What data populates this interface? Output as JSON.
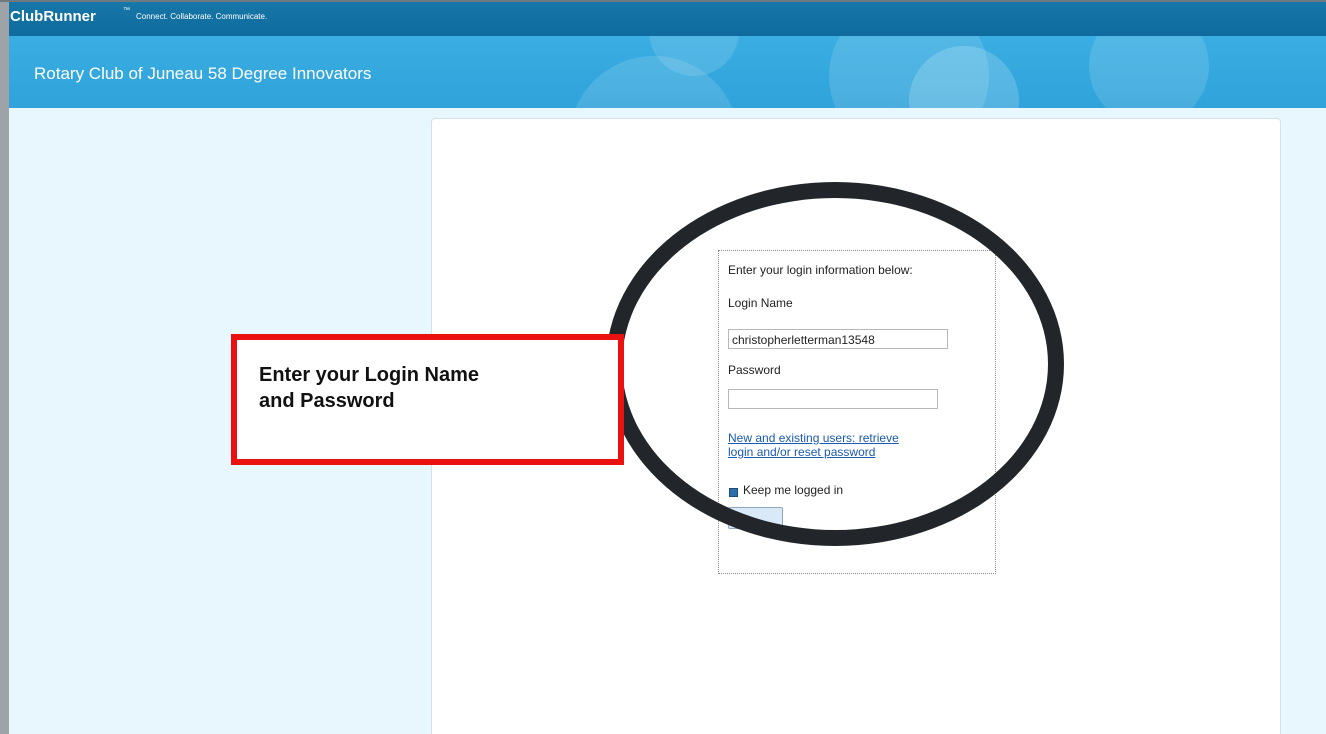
{
  "header": {
    "brand": "ClubRunner",
    "trademark": "™",
    "tagline": "Connect. Collaborate. Communicate."
  },
  "banner": {
    "club_name": "Rotary Club of Juneau 58 Degree Innovators"
  },
  "login": {
    "instructions": "Enter your login information below:",
    "login_name_label": "Login Name",
    "login_name_value": "christopherletterman13548",
    "password_label": "Password",
    "password_value": "",
    "retrieve_link": "New and existing users: retrieve login and/or reset password",
    "retrieve_link_line1": "New and existing users: retrieve",
    "retrieve_link_line2": "login and/or reset password",
    "keep_logged_in_label": "Keep me logged in",
    "keep_logged_in_checked": true
  },
  "annotation": {
    "line1": "Enter your Login Name",
    "line2": "and Password"
  },
  "colors": {
    "topbar": "#0f6b9d",
    "banner": "#35a9df",
    "page_background": "#e8f6fd",
    "annotation_border": "#ea1111",
    "highlight_ring": "#22262b",
    "link": "#1a5ab0"
  }
}
